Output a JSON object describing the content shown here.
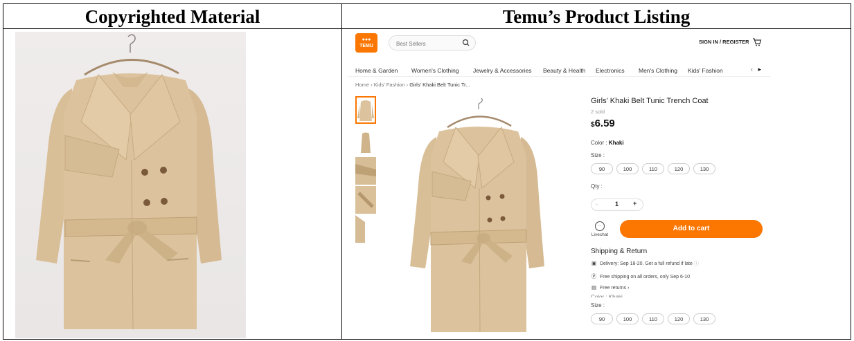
{
  "headers": {
    "left": "Copyrighted Material",
    "right": "Temu’s Product Listing"
  },
  "temu": {
    "logo_text": "TEMU",
    "search": {
      "placeholder": "Best Sellers"
    },
    "sign_in": "SIGN IN / REGISTER",
    "nav": [
      "Home & Garden",
      "Women's Clothing",
      "Jewelry & Accessories",
      "Beauty & Health",
      "Electronics",
      "Men's Clothing",
      "Kids' Fashion"
    ],
    "breadcrumb": {
      "home": "Home",
      "category": "Kids' Fashion",
      "current": "Girls' Khaki Belt Tunic Tr..."
    },
    "product": {
      "title": "Girls' Khaki Belt Tunic Trench Coat",
      "sold": "2 sold",
      "currency": "$",
      "price": "6.59",
      "color_label": "Color :",
      "color_value": "Khaki",
      "size_label": "Size :",
      "sizes": [
        "90",
        "100",
        "110",
        "120",
        "130"
      ],
      "qty_label": "Qty :",
      "qty_value": "1",
      "qty_minus": "-",
      "qty_plus": "+",
      "livechat": "Livechat",
      "add_to_cart": "Add to cart"
    },
    "shipping": {
      "title": "Shipping & Return",
      "delivery": "Delivery: Sep 18-20. Get a full refund if late",
      "free_shipping": "Free shipping on all orders, only Sep 6-10",
      "free_returns": "Free returns ›"
    },
    "repeat": {
      "color_label": "Color : Khaki",
      "size_label": "Size :",
      "sizes": [
        "90",
        "100",
        "110",
        "120",
        "130"
      ]
    },
    "colors": {
      "accent": "#fb7701",
      "coat": "#dcc39e"
    }
  }
}
